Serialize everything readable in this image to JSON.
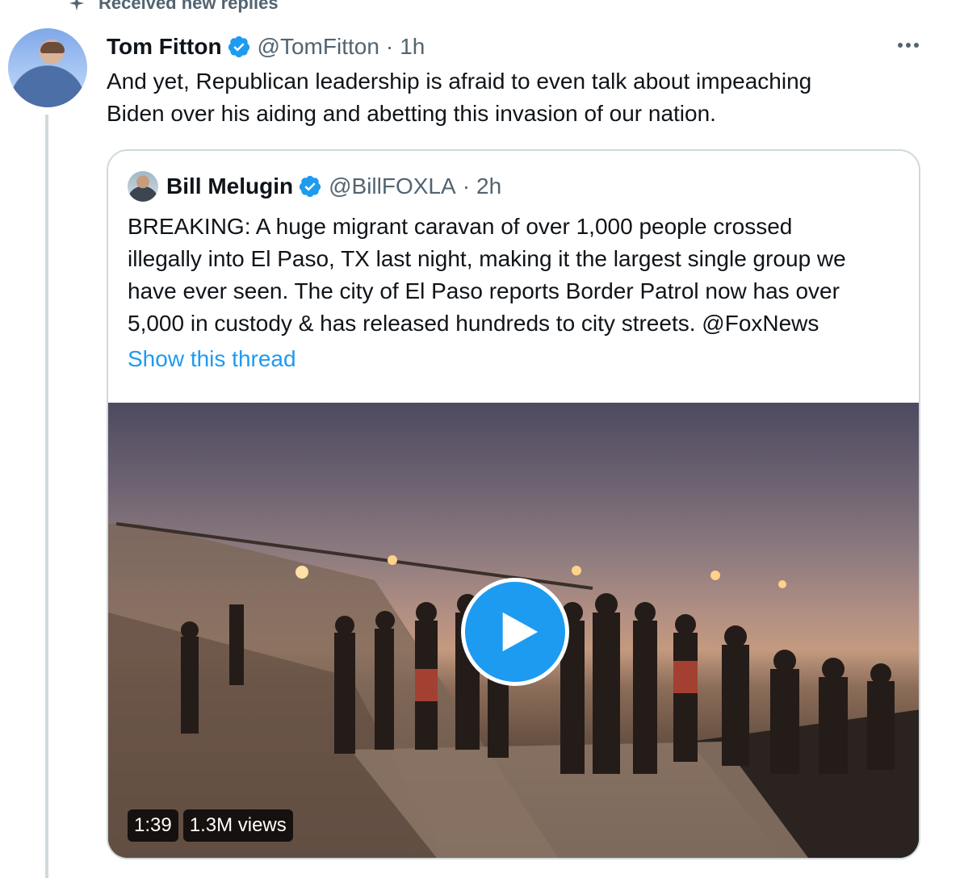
{
  "top_note": {
    "text": "Received new replies",
    "icon": "sparkle-icon"
  },
  "tweet": {
    "display_name": "Tom Fitton",
    "handle": "@TomFitton",
    "separator": "·",
    "time": "1h",
    "verified_icon": "verified-badge-icon",
    "text": "And yet, Republican leadership is afraid to even talk about impeaching\nBiden over his aiding and abetting this invasion of our nation."
  },
  "quote": {
    "display_name": "Bill Melugin",
    "handle": "@BillFOXLA",
    "separator": "·",
    "time": "2h",
    "text": "BREAKING: A huge migrant caravan of over 1,000 people crossed\nillegally into El Paso, TX last night, making it the largest single group we\nhave ever seen. The city of El Paso reports Border Patrol now has over\n5,000 in custody & has released hundreds to city streets. @FoxNews",
    "show_thread": "Show this thread",
    "video": {
      "duration": "1:39",
      "views": "1.3M views",
      "play_icon": "play-icon"
    }
  },
  "colors": {
    "accent": "#1d9bf0",
    "muted": "#536471",
    "border": "#cfd9de"
  }
}
